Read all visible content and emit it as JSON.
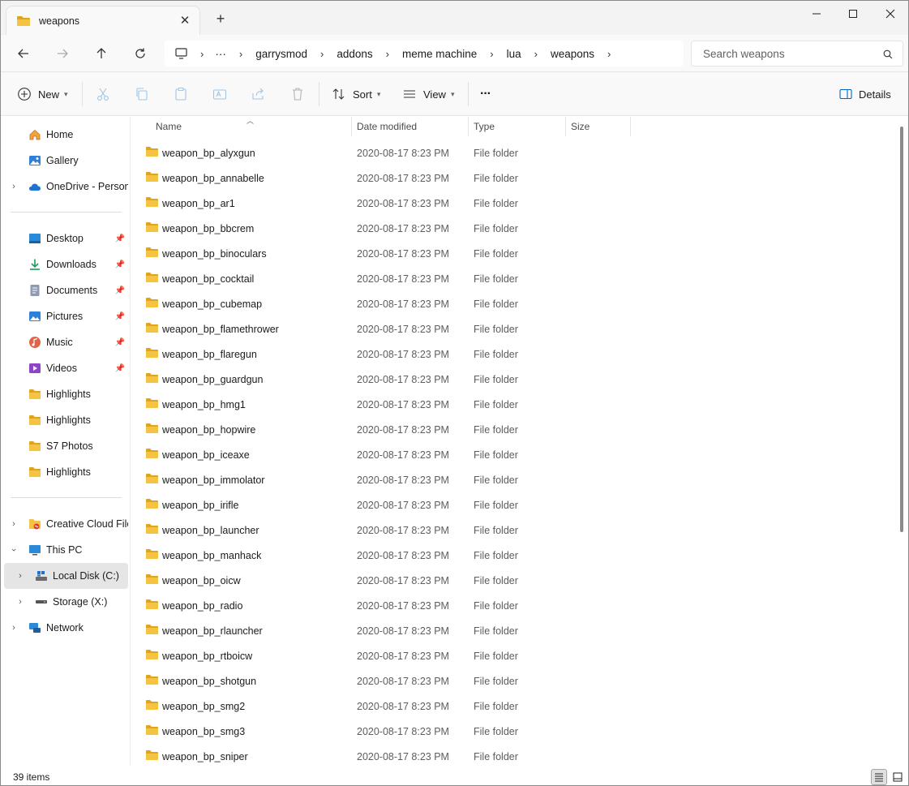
{
  "window": {
    "tab_title": "weapons",
    "close_tab": "✕",
    "new_tab": "+"
  },
  "nav": {
    "breadcrumb": [
      "garrysmod",
      "addons",
      "meme machine",
      "lua",
      "weapons"
    ],
    "search_placeholder": "Search weapons"
  },
  "toolbar": {
    "new_label": "New",
    "sort_label": "Sort",
    "view_label": "View",
    "more_label": "···",
    "details_label": "Details"
  },
  "sidebar": {
    "home": "Home",
    "gallery": "Gallery",
    "onedrive": "OneDrive - Persona",
    "quick": [
      {
        "label": "Desktop",
        "icon": "desktop-icon",
        "pinned": true
      },
      {
        "label": "Downloads",
        "icon": "downloads-icon",
        "pinned": true
      },
      {
        "label": "Documents",
        "icon": "documents-icon",
        "pinned": true
      },
      {
        "label": "Pictures",
        "icon": "pictures-icon",
        "pinned": true
      },
      {
        "label": "Music",
        "icon": "music-icon",
        "pinned": true
      },
      {
        "label": "Videos",
        "icon": "videos-icon",
        "pinned": true
      },
      {
        "label": "Highlights",
        "icon": "folder-icon",
        "pinned": false
      },
      {
        "label": "Highlights",
        "icon": "folder-icon",
        "pinned": false
      },
      {
        "label": "S7 Photos",
        "icon": "folder-icon",
        "pinned": false
      },
      {
        "label": "Highlights",
        "icon": "folder-icon",
        "pinned": false
      }
    ],
    "creative_cloud": "Creative Cloud Files",
    "this_pc": "This PC",
    "local_disk": "Local Disk (C:)",
    "storage": "Storage (X:)",
    "network": "Network"
  },
  "columns": {
    "name": "Name",
    "date": "Date modified",
    "type": "Type",
    "size": "Size"
  },
  "files": [
    {
      "name": "weapon_bp_alyxgun",
      "date": "2020-08-17 8:23 PM",
      "type": "File folder",
      "size": ""
    },
    {
      "name": "weapon_bp_annabelle",
      "date": "2020-08-17 8:23 PM",
      "type": "File folder",
      "size": ""
    },
    {
      "name": "weapon_bp_ar1",
      "date": "2020-08-17 8:23 PM",
      "type": "File folder",
      "size": ""
    },
    {
      "name": "weapon_bp_bbcrem",
      "date": "2020-08-17 8:23 PM",
      "type": "File folder",
      "size": ""
    },
    {
      "name": "weapon_bp_binoculars",
      "date": "2020-08-17 8:23 PM",
      "type": "File folder",
      "size": ""
    },
    {
      "name": "weapon_bp_cocktail",
      "date": "2020-08-17 8:23 PM",
      "type": "File folder",
      "size": ""
    },
    {
      "name": "weapon_bp_cubemap",
      "date": "2020-08-17 8:23 PM",
      "type": "File folder",
      "size": ""
    },
    {
      "name": "weapon_bp_flamethrower",
      "date": "2020-08-17 8:23 PM",
      "type": "File folder",
      "size": ""
    },
    {
      "name": "weapon_bp_flaregun",
      "date": "2020-08-17 8:23 PM",
      "type": "File folder",
      "size": ""
    },
    {
      "name": "weapon_bp_guardgun",
      "date": "2020-08-17 8:23 PM",
      "type": "File folder",
      "size": ""
    },
    {
      "name": "weapon_bp_hmg1",
      "date": "2020-08-17 8:23 PM",
      "type": "File folder",
      "size": ""
    },
    {
      "name": "weapon_bp_hopwire",
      "date": "2020-08-17 8:23 PM",
      "type": "File folder",
      "size": ""
    },
    {
      "name": "weapon_bp_iceaxe",
      "date": "2020-08-17 8:23 PM",
      "type": "File folder",
      "size": ""
    },
    {
      "name": "weapon_bp_immolator",
      "date": "2020-08-17 8:23 PM",
      "type": "File folder",
      "size": ""
    },
    {
      "name": "weapon_bp_irifle",
      "date": "2020-08-17 8:23 PM",
      "type": "File folder",
      "size": ""
    },
    {
      "name": "weapon_bp_launcher",
      "date": "2020-08-17 8:23 PM",
      "type": "File folder",
      "size": ""
    },
    {
      "name": "weapon_bp_manhack",
      "date": "2020-08-17 8:23 PM",
      "type": "File folder",
      "size": ""
    },
    {
      "name": "weapon_bp_oicw",
      "date": "2020-08-17 8:23 PM",
      "type": "File folder",
      "size": ""
    },
    {
      "name": "weapon_bp_radio",
      "date": "2020-08-17 8:23 PM",
      "type": "File folder",
      "size": ""
    },
    {
      "name": "weapon_bp_rlauncher",
      "date": "2020-08-17 8:23 PM",
      "type": "File folder",
      "size": ""
    },
    {
      "name": "weapon_bp_rtboicw",
      "date": "2020-08-17 8:23 PM",
      "type": "File folder",
      "size": ""
    },
    {
      "name": "weapon_bp_shotgun",
      "date": "2020-08-17 8:23 PM",
      "type": "File folder",
      "size": ""
    },
    {
      "name": "weapon_bp_smg2",
      "date": "2020-08-17 8:23 PM",
      "type": "File folder",
      "size": ""
    },
    {
      "name": "weapon_bp_smg3",
      "date": "2020-08-17 8:23 PM",
      "type": "File folder",
      "size": ""
    },
    {
      "name": "weapon_bp_sniper",
      "date": "2020-08-17 8:23 PM",
      "type": "File folder",
      "size": ""
    }
  ],
  "status": {
    "item_count": "39 items"
  },
  "colors": {
    "folder": "#f5c342",
    "folder_dark": "#e0a520",
    "accent": "#0067c0",
    "selected": "#e5e5e5"
  }
}
